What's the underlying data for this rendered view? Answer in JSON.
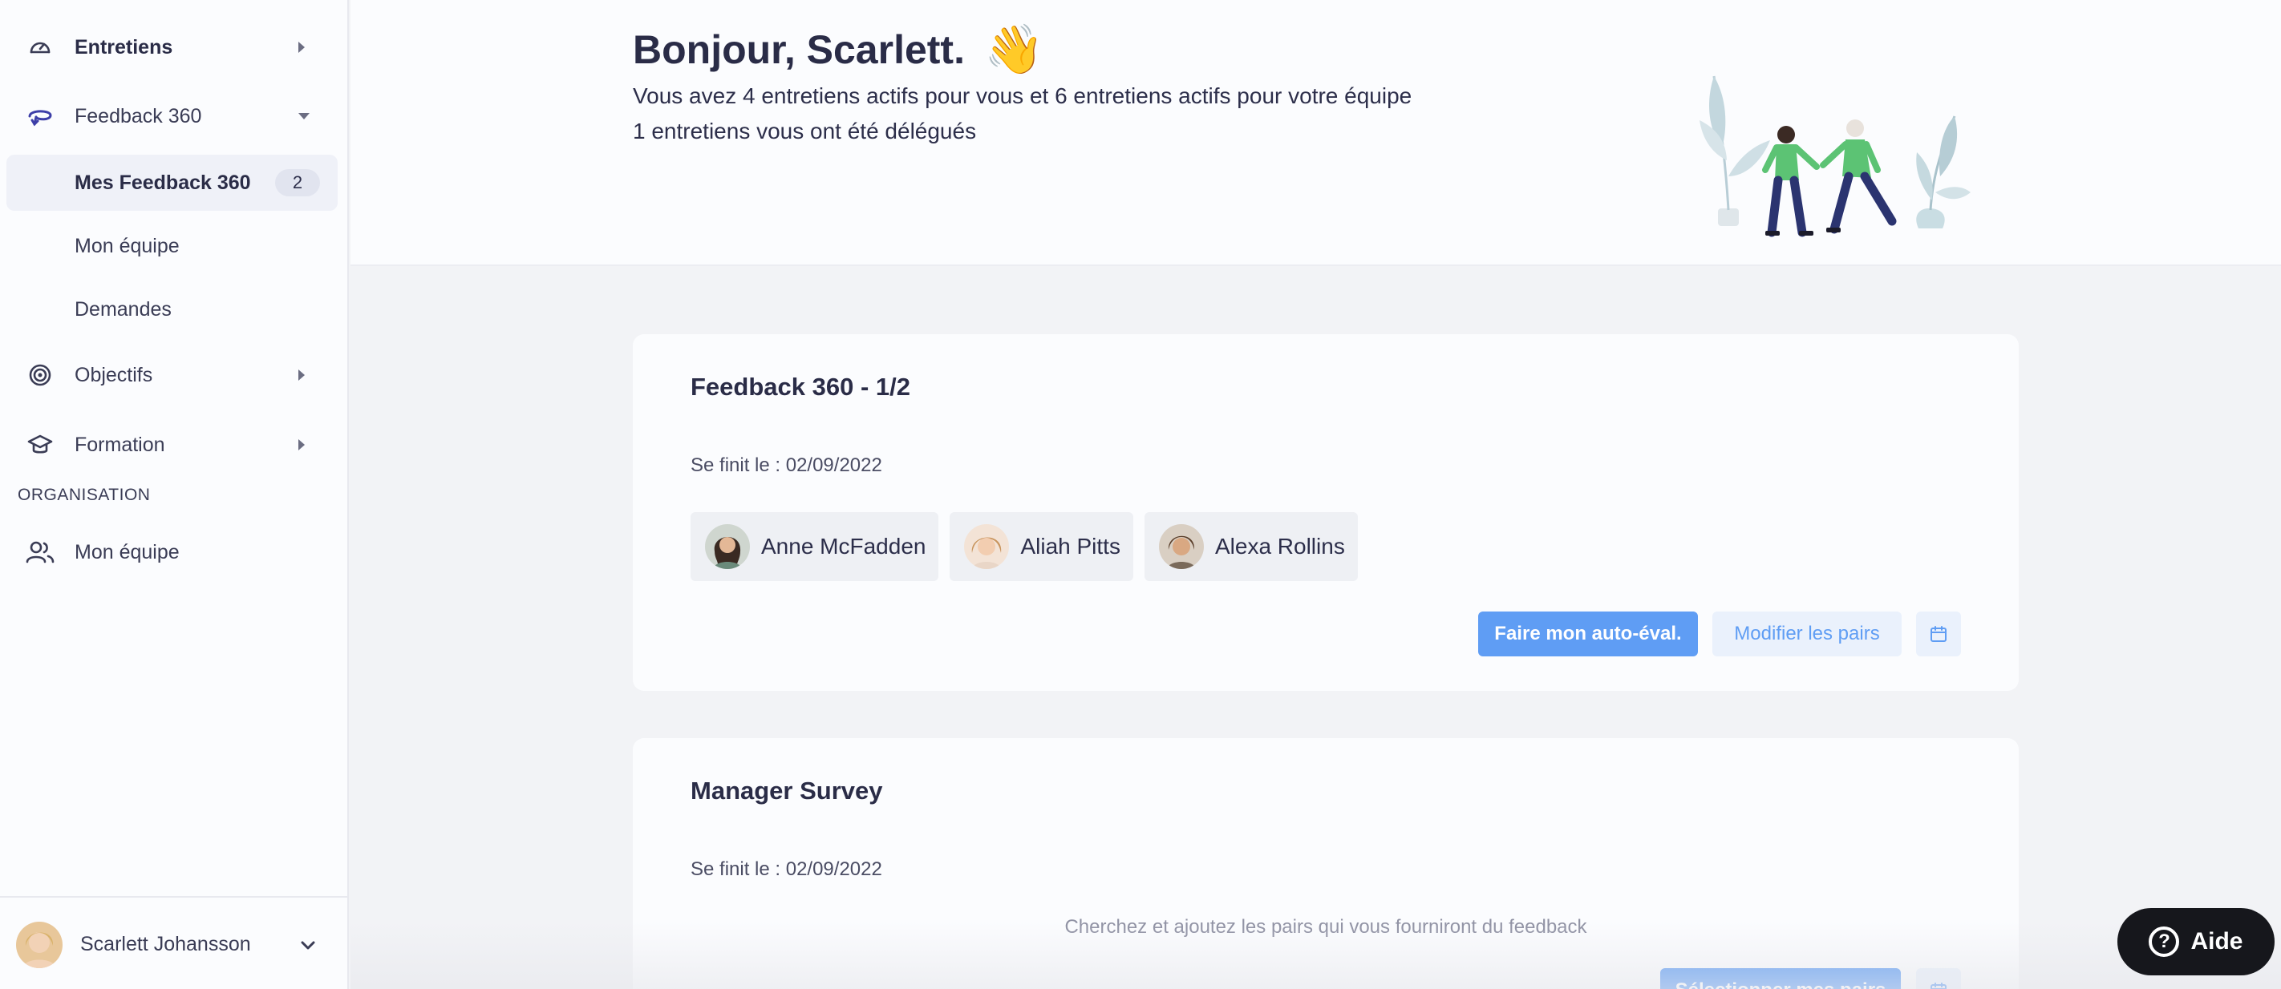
{
  "sidebar": {
    "items": [
      {
        "label": "Entretiens",
        "icon": "gauge-icon"
      },
      {
        "label": "Feedback 360",
        "icon": "feedback-loop-icon"
      },
      {
        "label": "Objectifs",
        "icon": "target-icon"
      },
      {
        "label": "Formation",
        "icon": "graduation-cap-icon"
      }
    ],
    "feedback_sub": [
      {
        "label": "Mes Feedback 360",
        "badge": "2"
      },
      {
        "label": "Mon équipe"
      },
      {
        "label": "Demandes"
      }
    ],
    "section_title": "ORGANISATION",
    "org_items": [
      {
        "label": "Mon équipe",
        "icon": "users-icon"
      }
    ],
    "user": {
      "name": "Scarlett Johansson"
    }
  },
  "header": {
    "greeting": "Bonjour, Scarlett.",
    "wave": "👋",
    "line1": "Vous avez 4 entretiens actifs pour vous et 6 entretiens actifs pour votre équipe",
    "line2": "1 entretiens vous ont été délégués"
  },
  "cards": [
    {
      "title": "Feedback 360 - 1/2",
      "date": "Se finit le : 02/09/2022",
      "peers": [
        {
          "name": "Anne McFadden"
        },
        {
          "name": "Aliah Pitts"
        },
        {
          "name": "Alexa Rollins"
        }
      ],
      "primary_btn": "Faire mon auto-éval.",
      "secondary_btn": "Modifier les pairs"
    },
    {
      "title": "Manager Survey",
      "date": "Se finit le : 02/09/2022",
      "hint": "Cherchez et ajoutez les pairs qui vous fourniront du feedback",
      "primary_btn": "Sélectionner mes pairs"
    }
  ],
  "help": {
    "label": "Aide",
    "glyph": "?"
  },
  "colors": {
    "accent": "#5f9df4",
    "sidebar_bg": "#fbfcfe",
    "page_bg": "#f2f3f6"
  }
}
